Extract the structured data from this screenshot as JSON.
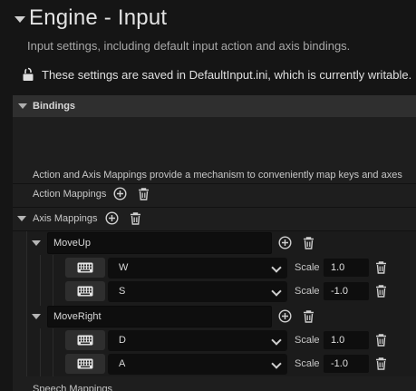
{
  "header": {
    "title": "Engine - Input",
    "subtitle": "Input settings, including default input action and axis bindings.",
    "notice": "These settings are saved in DefaultInput.ini, which is currently writable."
  },
  "category": {
    "label": "Bindings"
  },
  "description": "Action and Axis Mappings provide a mechanism to conveniently map keys and axes",
  "action_mappings": {
    "label": "Action Mappings"
  },
  "axis_mappings": {
    "label": "Axis Mappings",
    "groups": [
      {
        "name": "MoveUp",
        "keys": [
          {
            "key": "W",
            "scale_label": "Scale",
            "scale": "1.0"
          },
          {
            "key": "S",
            "scale_label": "Scale",
            "scale": "-1.0"
          }
        ]
      },
      {
        "name": "MoveRight",
        "keys": [
          {
            "key": "D",
            "scale_label": "Scale",
            "scale": "1.0"
          },
          {
            "key": "A",
            "scale_label": "Scale",
            "scale": "-1.0"
          }
        ]
      }
    ]
  },
  "speech_mappings": {
    "label": "Speech Mappings"
  },
  "colors": {
    "background": "#151515",
    "panel": "#1e1e1e",
    "category_bar": "#2f2f2f",
    "input_field": "#0e0e0e"
  }
}
